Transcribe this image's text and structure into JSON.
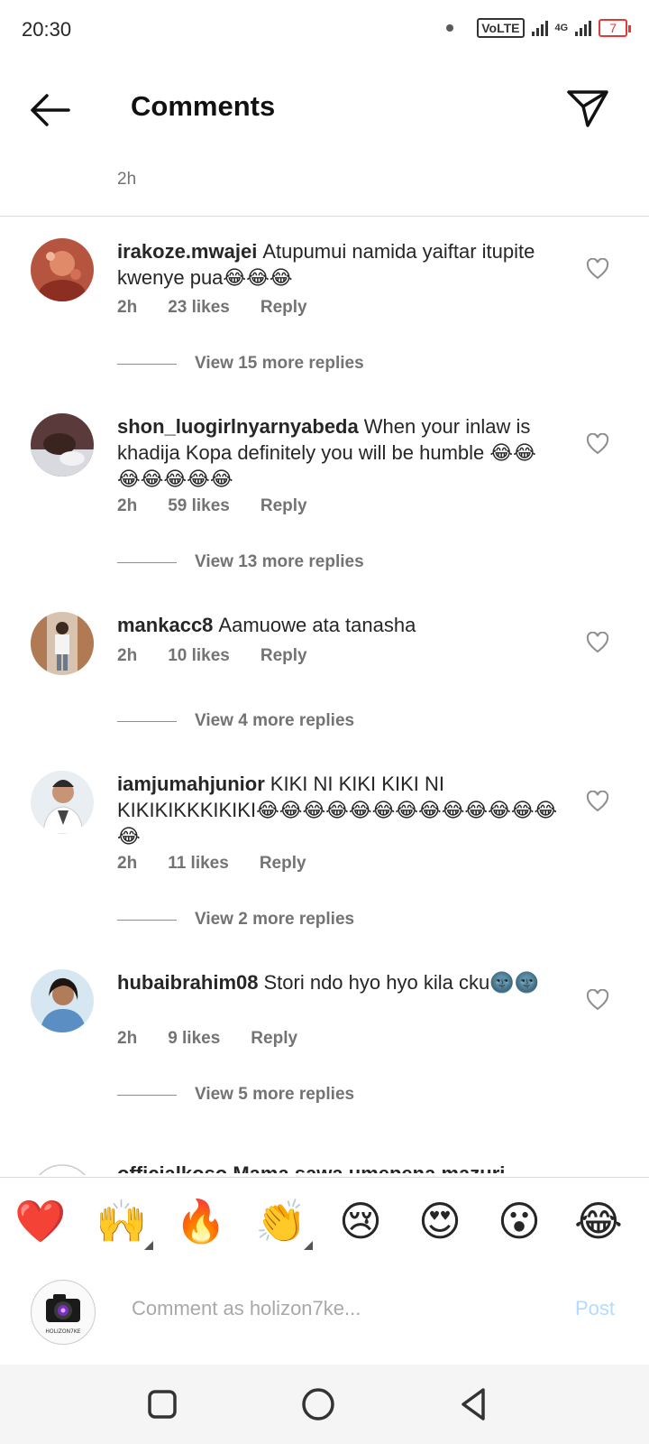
{
  "status": {
    "time": "20:30",
    "volte": "VoLTE",
    "network": "4G",
    "battery": "7"
  },
  "header": {
    "title": "Comments",
    "back_icon": "arrow-left-icon",
    "share_icon": "paper-plane-icon"
  },
  "top_partial": {
    "time": "2h"
  },
  "comments": [
    {
      "username": "irakoze.mwajei",
      "text": "Atupumui namida yaiftar itupite kwenye pua😂😂😂",
      "time": "2h",
      "likes": "23 likes",
      "reply": "Reply",
      "view_more": "View 15 more replies"
    },
    {
      "username": "shon_luogirlnyarnyabeda",
      "text": "When your inlaw is khadija Kopa definitely you will be humble 😂😂😂😂😂😂😂",
      "time": "2h",
      "likes": "59 likes",
      "reply": "Reply",
      "view_more": "View 13 more replies"
    },
    {
      "username": "mankacc8",
      "text": "Aamuowe ata tanasha",
      "time": "2h",
      "likes": "10 likes",
      "reply": "Reply",
      "view_more": "View 4 more replies"
    },
    {
      "username": "iamjumahjunior",
      "text": "KIKI NI KIKI KIKI NI KIKIKIKKKIKIKI😂😂😂😂😂😂😂😂😂😂😂😂😂😂",
      "time": "2h",
      "likes": "11 likes",
      "reply": "Reply",
      "view_more": "View 2 more replies"
    },
    {
      "username": "hubaibrahim08",
      "text": "Stori ndo hyo hyo kila cku🌚🌚",
      "time": "2h",
      "likes": "9 likes",
      "reply": "Reply",
      "view_more": "View 5 more replies"
    }
  ],
  "partial_comment": {
    "text": "officialkoso Mama sawa umepena mazuri"
  },
  "emoji_bar": [
    "❤️",
    "🙌",
    "🔥",
    "👏",
    "😢",
    "😍",
    "😮",
    "😂"
  ],
  "composer": {
    "placeholder": "Comment as holizon7ke...",
    "post_label": "Post",
    "avatar_caption": "HOLIZON7KE"
  },
  "colors": {
    "text": "#262626",
    "muted": "#737373",
    "post_disabled": "#b3dbff",
    "battery_low": "#e53935"
  }
}
